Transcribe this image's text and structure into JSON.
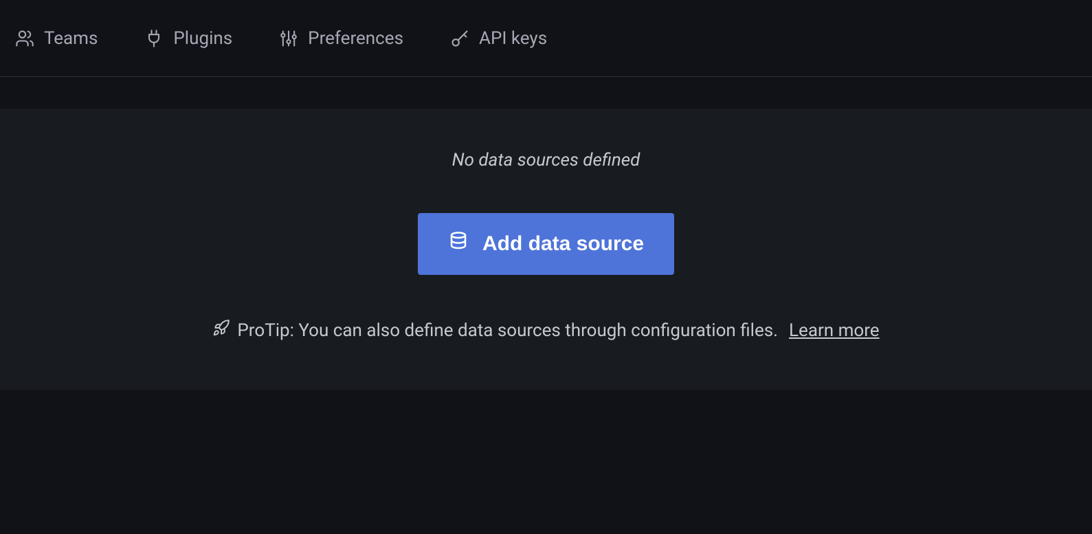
{
  "tabs": {
    "teams": "Teams",
    "plugins": "Plugins",
    "preferences": "Preferences",
    "apikeys": "API keys"
  },
  "main": {
    "empty_message": "No data sources defined",
    "add_button_label": "Add data source",
    "protip_text": "ProTip: You can also define data sources through configuration files.",
    "protip_link": "Learn more"
  }
}
